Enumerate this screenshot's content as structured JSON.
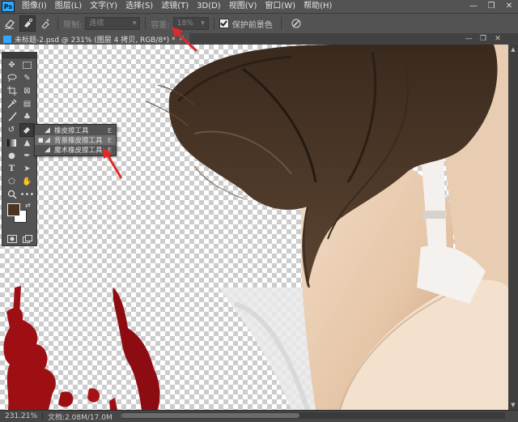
{
  "menubar": {
    "logo": "Ps",
    "items": [
      "图像(I)",
      "图层(L)",
      "文字(Y)",
      "选择(S)",
      "滤镜(T)",
      "3D(D)",
      "视图(V)",
      "窗口(W)",
      "帮助(H)"
    ],
    "window_controls": [
      "—",
      "❐",
      "✕"
    ]
  },
  "options": {
    "limit_label": "限制:",
    "limit_value": "连续",
    "tolerance_label": "容差:",
    "tolerance_value": "18%",
    "protect_label": "保护前景色",
    "protect_checked": true
  },
  "document": {
    "tab_title": "未标题-2.psd @ 231% (图层 4 拷贝, RGB/8*) *",
    "tab_close": "×",
    "controls": [
      "—",
      "❐",
      "✕"
    ]
  },
  "flyout": {
    "items": [
      {
        "label": "橡皮擦工具",
        "shortcut": "E",
        "icon": "eraser-icon",
        "selected": false
      },
      {
        "label": "背景橡皮擦工具",
        "shortcut": "E",
        "icon": "background-eraser-icon",
        "selected": true
      },
      {
        "label": "魔术橡皮擦工具",
        "shortcut": "E",
        "icon": "magic-eraser-icon",
        "selected": false
      }
    ]
  },
  "colors": {
    "foreground": "#4a3423",
    "background": "#ffffff",
    "arrow": "#e02a2a",
    "calligraphy": "#9e0f14"
  },
  "status": {
    "zoom": "231.21%",
    "doc_info": "文档:2.08M/17.0M",
    "arrow": "›"
  }
}
